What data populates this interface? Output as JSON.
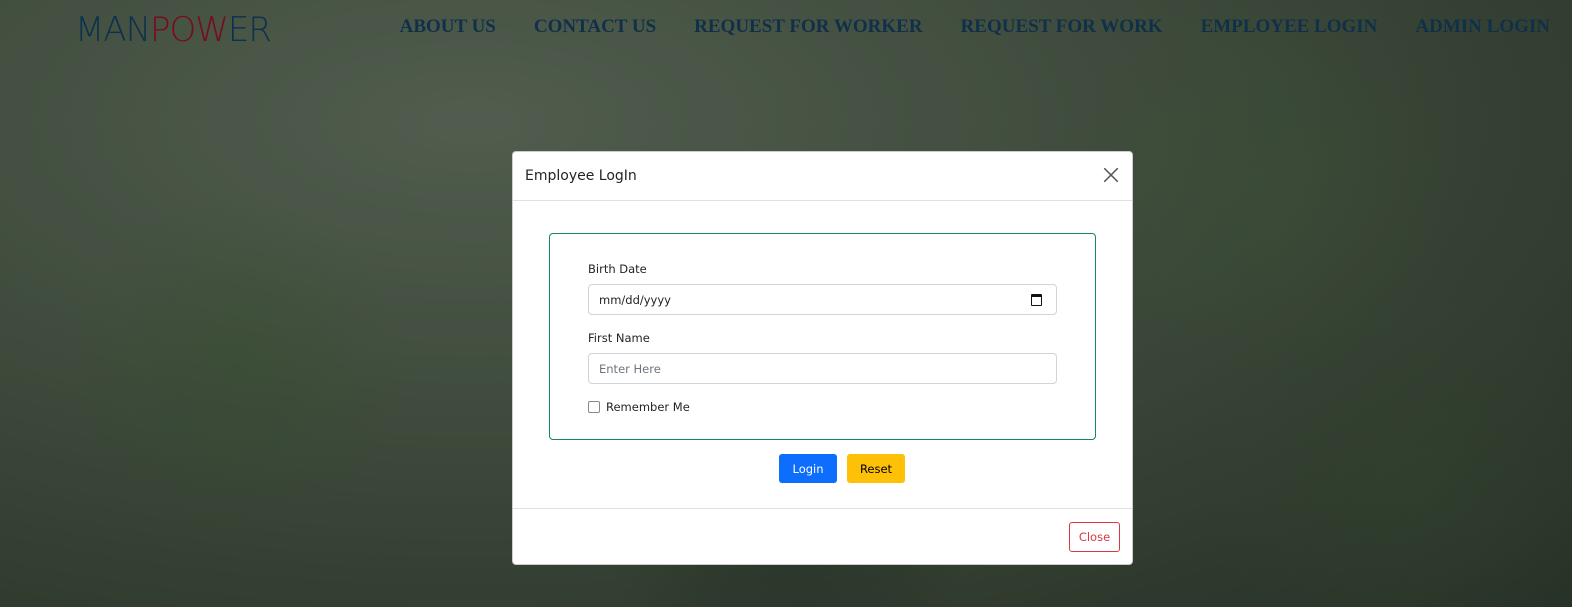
{
  "nav": {
    "logo_part1": "MAN",
    "logo_part2": "POW",
    "logo_part3": "ER",
    "links": [
      "ABOUT US",
      "CONTACT US",
      "REQUEST FOR WORKER",
      "REQUEST FOR WORK",
      "EMPLOYEE LOGIN",
      "ADMIN LOGIN"
    ]
  },
  "modal": {
    "title": "Employee LogIn",
    "birth_date_label": "Birth Date",
    "birth_date_value": "mm/dd/yyyy",
    "first_name_label": "First Name",
    "first_name_placeholder": "Enter Here",
    "remember_label": "Remember Me",
    "login_label": "Login",
    "reset_label": "Reset",
    "close_label": "Close"
  },
  "colors": {
    "brand": "#0f3a5a",
    "brand_accent": "#8c0f20",
    "primary": "#0d6efd",
    "warning": "#ffc107",
    "danger": "#dc3545",
    "success": "#198754"
  }
}
